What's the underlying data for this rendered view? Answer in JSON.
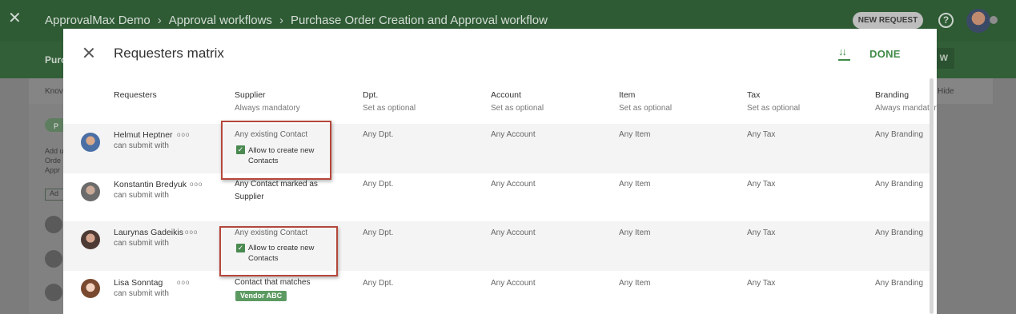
{
  "app": {
    "breadcrumb": [
      "ApprovalMax Demo",
      "Approval workflows",
      "Purchase Order Creation and Approval workflow"
    ],
    "new_request_label": "NEW REQUEST",
    "help_glyph": "?",
    "close_glyph": "✕",
    "band_title": "Purc",
    "band_button": "W",
    "strip_left": "Knov",
    "strip_right": "Hide",
    "bg_pill": "P",
    "bg_text": [
      "Add u",
      "Orde",
      "Appr"
    ],
    "bg_button": "Ad",
    "colors": {
      "brand_green": "#2e5b34",
      "accent_green": "#3f8a47",
      "highlight_red": "#b5473b"
    }
  },
  "modal": {
    "title": "Requesters matrix",
    "done_label": "DONE",
    "sort_icon": "sort-icon",
    "columns": [
      {
        "header": "Requesters",
        "sub": ""
      },
      {
        "header": "Supplier",
        "sub": "Always mandatory"
      },
      {
        "header": "Dpt.",
        "sub": "Set as optional"
      },
      {
        "header": "Account",
        "sub": "Set as optional"
      },
      {
        "header": "Item",
        "sub": "Set as optional"
      },
      {
        "header": "Tax",
        "sub": "Set as optional"
      },
      {
        "header": "Branding",
        "sub": "Always mandatory"
      }
    ],
    "rows": [
      {
        "name": "Helmut Heptner",
        "dots": "ooo",
        "sub": "can submit with",
        "supplier": "Any existing Contact",
        "checkbox_label_1": "Allow to create new",
        "checkbox_label_2": "Contacts",
        "dpt": "Any Dpt.",
        "account": "Any Account",
        "item": "Any Item",
        "tax": "Any Tax",
        "branding": "Any Branding"
      },
      {
        "name": "Konstantin Bredyuk",
        "dots": "ooo",
        "sub": "can submit with",
        "supplier_1": "Any Contact marked as",
        "supplier_2": "Supplier",
        "dpt": "Any Dpt.",
        "account": "Any Account",
        "item": "Any Item",
        "tax": "Any Tax",
        "branding": "Any Branding"
      },
      {
        "name": "Laurynas Gadeikis",
        "dots": "ooo",
        "sub": "can submit with",
        "supplier": "Any existing Contact",
        "checkbox_label_1": "Allow to create new",
        "checkbox_label_2": "Contacts",
        "dpt": "Any Dpt.",
        "account": "Any Account",
        "item": "Any Item",
        "tax": "Any Tax",
        "branding": "Any Branding"
      },
      {
        "name": "Lisa Sonntag",
        "dots": "ooo",
        "sub": "can submit with",
        "supplier": "Contact that matches",
        "vendor_tag": "Vendor ABC",
        "dpt": "Any Dpt.",
        "account": "Any Account",
        "item": "Any Item",
        "tax": "Any Tax",
        "branding": "Any Branding"
      }
    ]
  }
}
